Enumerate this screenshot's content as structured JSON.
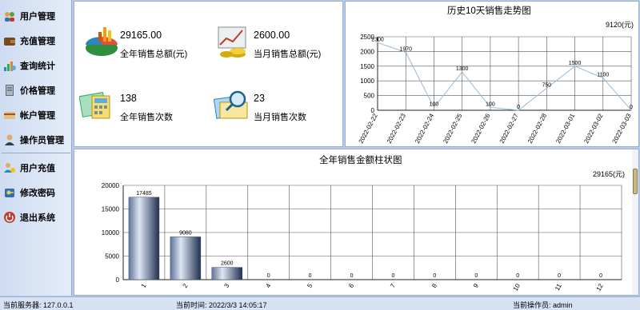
{
  "sidebar": {
    "items": [
      {
        "label": "用户管理",
        "icon": "users-icon"
      },
      {
        "label": "充值管理",
        "icon": "wallet-icon"
      },
      {
        "label": "查询统计",
        "icon": "chart-icon"
      },
      {
        "label": "价格管理",
        "icon": "price-book-icon"
      },
      {
        "label": "帐户管理",
        "icon": "account-card-icon"
      },
      {
        "label": "操作员管理",
        "icon": "operator-icon"
      },
      {
        "label": "用户充值",
        "icon": "recharge-icon"
      },
      {
        "label": "修改密码",
        "icon": "key-icon"
      },
      {
        "label": "退出系统",
        "icon": "power-icon"
      }
    ]
  },
  "stats": {
    "year_total": {
      "value": "29165.00",
      "label": "全年销售总额(元)",
      "icon": "pie-chart-icon"
    },
    "month_total": {
      "value": "2600.00",
      "label": "当月销售总额(元)",
      "icon": "money-chart-icon"
    },
    "year_count": {
      "value": "138",
      "label": "全年销售次数",
      "icon": "calculator-icon"
    },
    "month_count": {
      "value": "23",
      "label": "当月销售次数",
      "icon": "magnifier-icon"
    }
  },
  "trend": {
    "title": "历史10天销售走势图",
    "total": "9120(元)"
  },
  "bars": {
    "title": "全年销售金额柱状图",
    "total": "29165(元)"
  },
  "status": {
    "server": "当前服务器:   127.0.0.1",
    "time": "当前时间:   2022/3/3  14:05:17",
    "operator": "当前操作员:   admin"
  },
  "chart_data": [
    {
      "type": "line",
      "title": "历史10天销售走势图",
      "x": [
        "2022-02-22",
        "2022-02-23",
        "2022-02-24",
        "2022-02-25",
        "2022-02-26",
        "2022-02-27",
        "2022-02-28",
        "2022-03-01",
        "2022-03-02",
        "2022-03-03"
      ],
      "values": [
        2300,
        1970,
        100,
        1300,
        100,
        0,
        750,
        1500,
        1100,
        0
      ],
      "ylim": [
        0,
        2500
      ],
      "yticks": [
        0,
        500,
        1000,
        1500,
        2000,
        2500
      ],
      "grid": true,
      "color": "#9ab8d8"
    },
    {
      "type": "bar",
      "title": "全年销售金额柱状图",
      "categories": [
        "1",
        "2",
        "3",
        "4",
        "5",
        "6",
        "7",
        "8",
        "9",
        "10",
        "11",
        "12"
      ],
      "values": [
        17485,
        9080,
        2600,
        0,
        0,
        0,
        0,
        0,
        0,
        0,
        0,
        0
      ],
      "ylim": [
        0,
        20000
      ],
      "yticks": [
        0,
        5000,
        10000,
        15000,
        20000
      ],
      "grid": true,
      "color": "#8fa2c4"
    }
  ]
}
